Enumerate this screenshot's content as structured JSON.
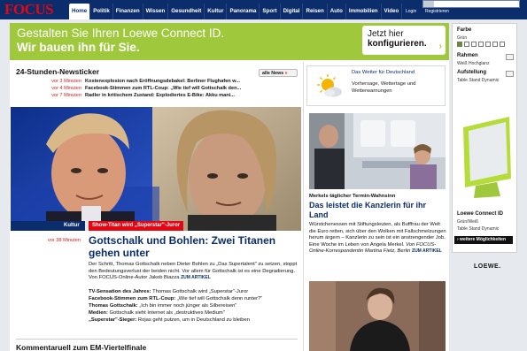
{
  "header": {
    "logo": "FOCUS",
    "nav": [
      "Home",
      "Politik",
      "Finanzen",
      "Wissen",
      "Gesundheit",
      "Kultur",
      "Panorama",
      "Sport",
      "Digital",
      "Reisen",
      "Auto",
      "Immobilien",
      "Video"
    ],
    "login": "Login",
    "register": "Registrieren"
  },
  "banner": {
    "line1": "Gestalten Sie Ihren Loewe Connect ID.",
    "line2": "Wir bauen ihn für Sie.",
    "cta_line1": "Jetzt hier",
    "cta_line2": "konfigurieren.",
    "cta_arrow": "›",
    "accent": "#9fc83c"
  },
  "newsticker": {
    "title": "24-Stunden-Newsticker",
    "all_news": "alle News",
    "all_news_arrow": "»",
    "items": [
      {
        "time": "vor 3 Minuten",
        "text": "Kostenexplosion nach Eröffnungsdebakel: Berliner Flughafen w..."
      },
      {
        "time": "vor 4 Minuten",
        "text": "Facebook-Stimmen zum RTL-Coup: „Wie tief will Gottschalk den..."
      },
      {
        "time": "vor 7 Minuten",
        "text": "Radler in kritischem Zustand: Explodiertes E-Bike: Akku mani..."
      }
    ]
  },
  "lead": {
    "section": "Kultur",
    "kicker": "Show-Titan wird „Superstar\"-Juror",
    "time": "vor 38 Minuten",
    "headline": "Gottschalk und Bohlen: Zwei Titanen gehen unter",
    "teaser": "Der Schritt, Thomas Gottschalk neben Dieter Bohlen zu „Das Supertalent\" zu setzen, stoppt den Bedeutungsverlust der beiden nicht. Vor allem für Gottschalk ist es eine Degradierung. Von FOCUS-Online-Autor Jakob Biazza",
    "more": "ZUM ARTIKEL",
    "related": [
      {
        "bold": "TV-Sensation des Jahres:",
        "text": "Thomas Gottschalk wird „Superstar\"-Juror"
      },
      {
        "bold": "Facebook-Stimmen zum RTL-Coup:",
        "text": "„Wie tief will Gottschalk denn runter?\""
      },
      {
        "bold": "Thomas Gottschalk:",
        "text": "„Ich bin immer noch jünger als Silbereisen\""
      },
      {
        "bold": "Medien:",
        "text": "Gottschalk sieht Internet als „destruktives Medium\""
      },
      {
        "bold": "„Superstar\"-Sieger:",
        "text": "Rojas geht putzen, um in Deutschland zu bleiben"
      }
    ]
  },
  "bottom": {
    "title": "Kommentaruell zum EM-Viertelfinale"
  },
  "weather": {
    "title": "Das Wetter für Deutschland",
    "sub": "Vorhersage, Wettertage und Wetterwarnungen"
  },
  "merkel": {
    "kicker": "Merkels täglicher Termin-Wahnsinn",
    "headline": "Das leistet die Kanzlerin für ihr Land",
    "teaser": "Würstchenessen mit Stiftungsleuten, als Bufffrau der Welt die Euro retten, sich über den Wolken mit Fallschmelzungen herum ärgern – Kanzlerin zu sein ist ein anstrengender Job. Eine Woche im Leben von Angela Merkel.",
    "author": "Von FOCUS-Online-Korrespondentin Martina Fietz, Berlin",
    "more": "ZUM ARTIKEL"
  },
  "ad": {
    "farbe_label": "Farbe",
    "farbe_value": "Grün",
    "rahmen_label": "Rahmen",
    "rahmen_value": "Weiß Hochglanz",
    "aufstellung_label": "Aufstellung",
    "aufstellung_value": "Table Stand Dynamic",
    "model": "Loewe Connect ID",
    "model_spec1": "Grün/Weiß",
    "model_spec2": "Table Stand Dynamic",
    "button": "› weitere Möglichkeiten",
    "brand": "LOEWE."
  }
}
